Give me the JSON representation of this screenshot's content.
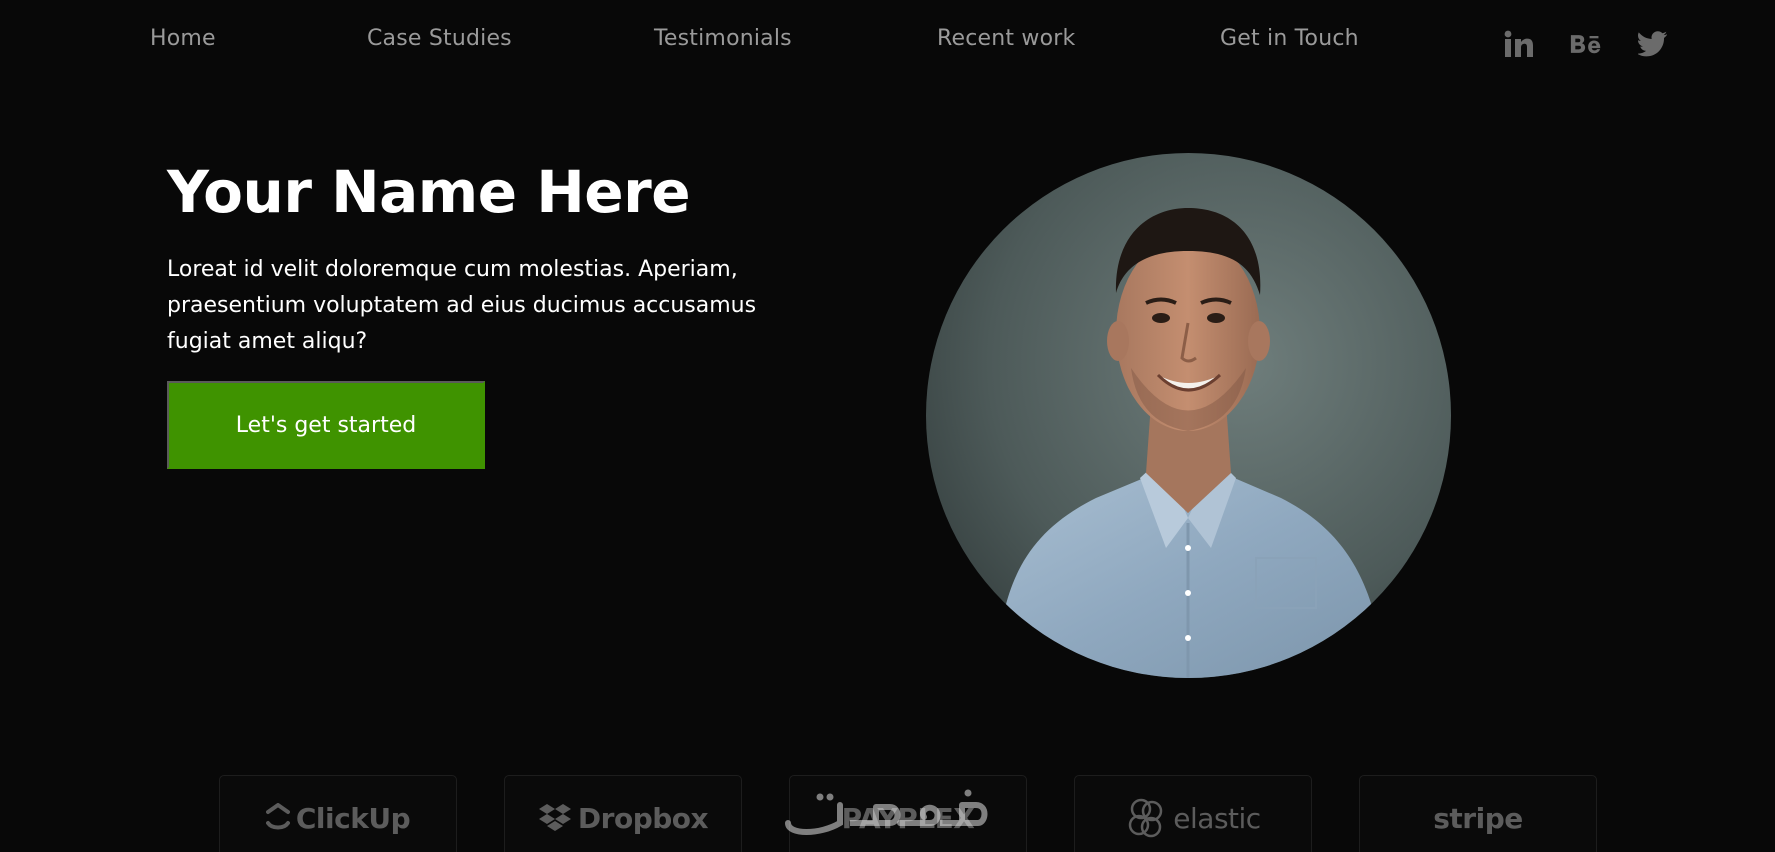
{
  "nav": {
    "links": [
      {
        "label": "Home"
      },
      {
        "label": "Case Studies"
      },
      {
        "label": "Testimonials"
      },
      {
        "label": "Recent work"
      },
      {
        "label": "Get in Touch"
      }
    ],
    "social": [
      "linkedin-icon",
      "behance-icon",
      "twitter-icon"
    ]
  },
  "hero": {
    "title": "Your Name Here",
    "description_lines": [
      "Loreat id velit doloremque cum molestias. Aperiam,",
      "praesentium voluptatem ad eius ducimus accusamus",
      "fugiat amet aliqu?"
    ],
    "cta_label": "Let's get started"
  },
  "logos": [
    {
      "name": "ClickUp",
      "icon": "clickup-icon"
    },
    {
      "name": "Dropbox",
      "icon": "dropbox-icon"
    },
    {
      "name": "PAYPLEX",
      "icon": ""
    },
    {
      "name": "elastic",
      "icon": "elastic-icon"
    },
    {
      "name": "stripe",
      "icon": ""
    }
  ],
  "watermark": "خمسات",
  "colors": {
    "background": "#080808",
    "nav_text": "#9a9a9a",
    "accent_green": "#3f9300",
    "logo_gray": "#5c5c5c"
  }
}
